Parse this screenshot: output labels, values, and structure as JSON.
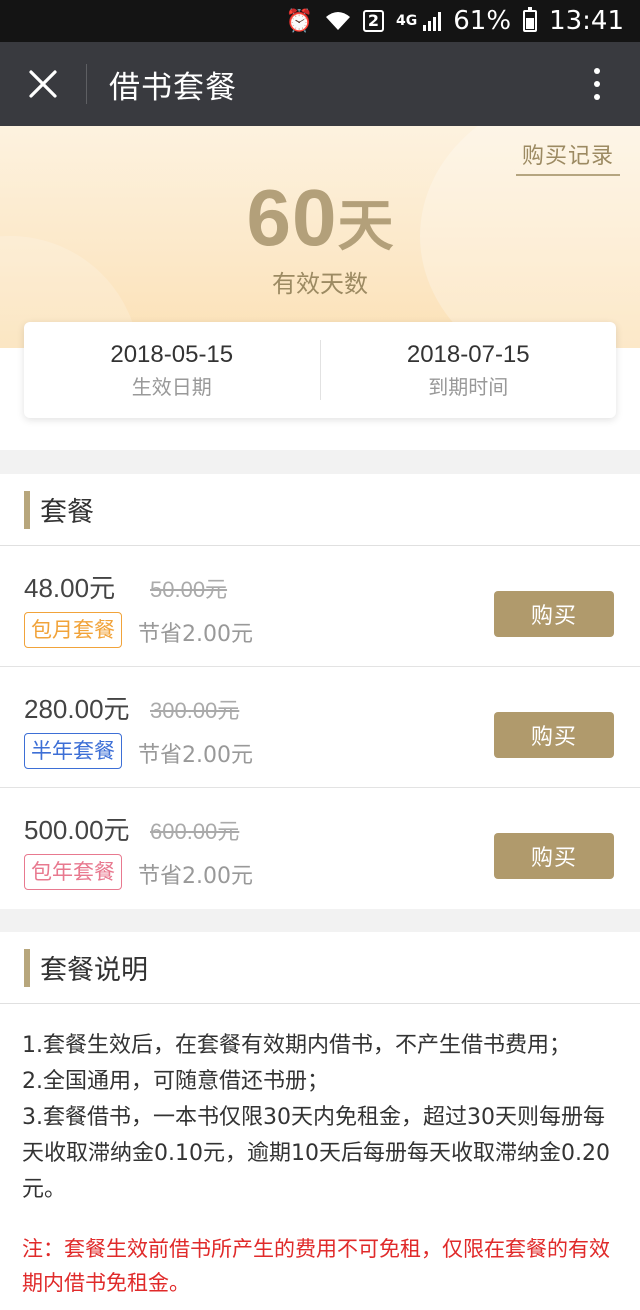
{
  "status_bar": {
    "alarm_icon": "alarm-icon",
    "wifi_icon": "wifi-icon",
    "sim_label": "2",
    "network": "4G",
    "battery_percent": "61%",
    "time": "13:41"
  },
  "nav": {
    "close_icon": "close-icon",
    "title": "借书套餐",
    "more_icon": "more-vertical-icon"
  },
  "hero": {
    "record_link": "购买记录",
    "days_value": "60",
    "days_unit": "天",
    "days_label": "有效天数"
  },
  "dates": {
    "start_value": "2018-05-15",
    "start_label": "生效日期",
    "end_value": "2018-07-15",
    "end_label": "到期时间"
  },
  "packages_section": {
    "title": "套餐",
    "items": [
      {
        "price": "48.00元",
        "original": "50.00元",
        "tag": "包月套餐",
        "saving": "节省2.00元",
        "buy_label": "购买"
      },
      {
        "price": "280.00元",
        "original": "300.00元",
        "tag": "半年套餐",
        "saving": "节省2.00元",
        "buy_label": "购买"
      },
      {
        "price": "500.00元",
        "original": "600.00元",
        "tag": "包年套餐",
        "saving": "节省2.00元",
        "buy_label": "购买"
      }
    ]
  },
  "description_section": {
    "title": "套餐说明",
    "lines": [
      "1.套餐生效后，在套餐有效期内借书，不产生借书费用；",
      "2.全国通用，可随意借还书册；",
      "3.套餐借书，一本书仅限30天内免租金，超过30天则每册每天收取滞纳金0.10元，逾期10天后每册每天收取滞纳金0.20元。"
    ],
    "note": "注：套餐生效前借书所产生的费用不可免租，仅限在套餐的有效期内借书免租金。"
  },
  "colors": {
    "accent": "#b09a6c",
    "nav_bg": "#393a3f",
    "month_tag": "#f1a33a",
    "half_year_tag": "#3d6fd6",
    "year_tag": "#e8798f",
    "note_red": "#e02a2a"
  }
}
